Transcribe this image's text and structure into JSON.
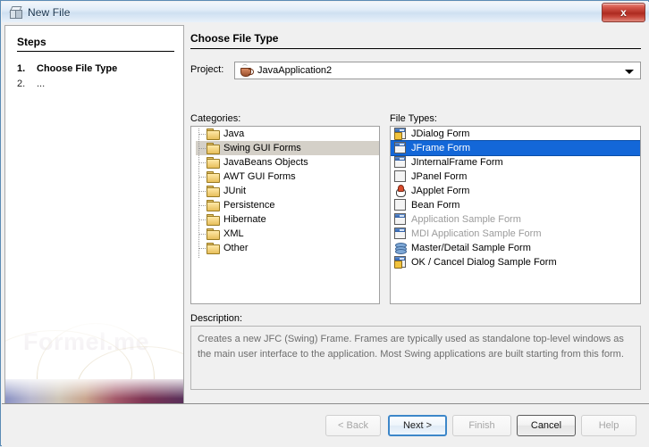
{
  "window": {
    "title": "New File",
    "title_icon": "cube-icon",
    "close_label": "x"
  },
  "steps_pane": {
    "heading": "Steps",
    "items": [
      {
        "number": "1.",
        "label": "Choose File Type",
        "current": true
      },
      {
        "number": "2.",
        "label": "...",
        "current": false
      }
    ],
    "watermark_text": "Formel.me"
  },
  "main": {
    "heading": "Choose File Type",
    "project": {
      "label": "Project:",
      "value": "JavaApplication2",
      "icon": "java-coffee-cup-icon",
      "arrow_icon": "chevron-down-icon"
    },
    "categories": {
      "label": "Categories:",
      "items": [
        {
          "label": "Java",
          "selected": false
        },
        {
          "label": "Swing GUI Forms",
          "selected": true
        },
        {
          "label": "JavaBeans Objects",
          "selected": false
        },
        {
          "label": "AWT GUI Forms",
          "selected": false
        },
        {
          "label": "JUnit",
          "selected": false
        },
        {
          "label": "Persistence",
          "selected": false
        },
        {
          "label": "Hibernate",
          "selected": false
        },
        {
          "label": "XML",
          "selected": false
        },
        {
          "label": "Other",
          "selected": false
        }
      ]
    },
    "file_types": {
      "label": "File Types:",
      "items": [
        {
          "label": "JDialog Form",
          "icon": "dialog-form-icon",
          "selected": false,
          "dim": false
        },
        {
          "label": "JFrame Form",
          "icon": "frame-form-icon",
          "selected": true,
          "dim": false
        },
        {
          "label": "JInternalFrame Form",
          "icon": "internal-frame-icon",
          "selected": false,
          "dim": false
        },
        {
          "label": "JPanel Form",
          "icon": "panel-form-icon",
          "selected": false,
          "dim": false
        },
        {
          "label": "JApplet Form",
          "icon": "applet-duke-icon",
          "selected": false,
          "dim": false
        },
        {
          "label": "Bean Form",
          "icon": "bean-form-icon",
          "selected": false,
          "dim": false
        },
        {
          "label": "Application Sample Form",
          "icon": "app-sample-icon",
          "selected": false,
          "dim": true
        },
        {
          "label": "MDI Application Sample Form",
          "icon": "mdi-sample-icon",
          "selected": false,
          "dim": true
        },
        {
          "label": "Master/Detail Sample Form",
          "icon": "database-icon",
          "selected": false,
          "dim": false
        },
        {
          "label": "OK / Cancel Dialog Sample Form",
          "icon": "ok-cancel-dialog-icon",
          "selected": false,
          "dim": false
        }
      ]
    },
    "description": {
      "label": "Description:",
      "text": "Creates a new JFC (Swing) Frame. Frames are typically used as standalone top-level windows as the main user interface to the application. Most Swing applications are built starting from this form."
    }
  },
  "buttons": {
    "back": {
      "label": "< Back",
      "enabled": false
    },
    "next": {
      "label": "Next >",
      "enabled": true,
      "default": true
    },
    "finish": {
      "label": "Finish",
      "enabled": false
    },
    "cancel": {
      "label": "Cancel",
      "enabled": true
    },
    "help": {
      "label": "Help",
      "enabled": false
    }
  },
  "colors": {
    "selection_blue": "#1367d8",
    "selection_gray": "#d4d0c8",
    "dialog_bg": "#f0f0f0",
    "close_red": "#ad2b21",
    "default_button_border": "#3d87c9"
  }
}
